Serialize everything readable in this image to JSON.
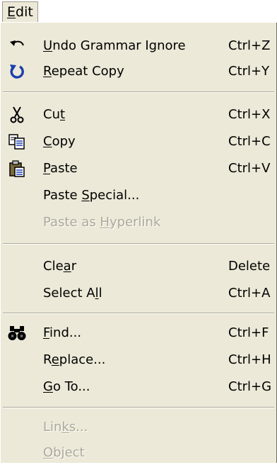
{
  "menubar": {
    "title_prefix": "",
    "title_mnemonic": "E",
    "title_rest": "dit"
  },
  "items": [
    {
      "pre": "",
      "key": "U",
      "post": "ndo Grammar Ignore",
      "shortcut": "Ctrl+Z",
      "icon": "undo-icon"
    },
    {
      "pre": "",
      "key": "R",
      "post": "epeat Copy",
      "shortcut": "Ctrl+Y",
      "icon": "repeat-icon"
    },
    {
      "pre": "Cu",
      "key": "t",
      "post": "",
      "shortcut": "Ctrl+X",
      "icon": "scissors-icon"
    },
    {
      "pre": "",
      "key": "C",
      "post": "opy",
      "shortcut": "Ctrl+C",
      "icon": "copy-icon"
    },
    {
      "pre": "",
      "key": "P",
      "post": "aste",
      "shortcut": "Ctrl+V",
      "icon": "paste-icon"
    },
    {
      "pre": "Paste ",
      "key": "S",
      "post": "pecial...",
      "shortcut": ""
    },
    {
      "pre": "Paste as ",
      "key": "H",
      "post": "yperlink",
      "shortcut": "",
      "disabled": true
    },
    {
      "pre": "Cle",
      "key": "a",
      "post": "r",
      "shortcut": "Delete"
    },
    {
      "pre": "Select A",
      "key": "l",
      "post": "l",
      "shortcut": "Ctrl+A"
    },
    {
      "pre": "",
      "key": "F",
      "post": "ind...",
      "shortcut": "Ctrl+F",
      "icon": "binoculars-icon"
    },
    {
      "pre": "R",
      "key": "e",
      "post": "place...",
      "shortcut": "Ctrl+H"
    },
    {
      "pre": "",
      "key": "G",
      "post": "o To...",
      "shortcut": "Ctrl+G"
    },
    {
      "pre": "Lin",
      "key": "k",
      "post": "s...",
      "shortcut": "",
      "disabled": true
    },
    {
      "pre": "",
      "key": "O",
      "post": "bject",
      "shortcut": "",
      "disabled": true
    }
  ]
}
